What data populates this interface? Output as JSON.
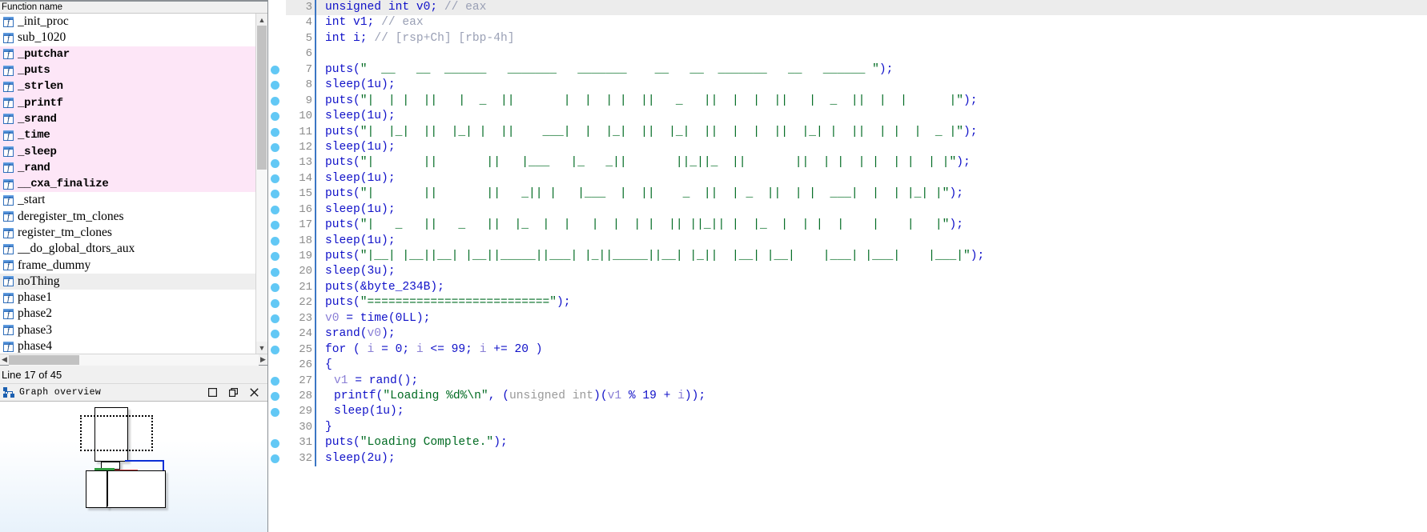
{
  "functions_panel": {
    "header": "Function name",
    "status": "Line 17 of 45",
    "icon_letter": "f",
    "items": [
      {
        "label": "_init_proc",
        "state": "normal"
      },
      {
        "label": "sub_1020",
        "state": "normal"
      },
      {
        "label": "_putchar",
        "state": "pink"
      },
      {
        "label": "_puts",
        "state": "pink"
      },
      {
        "label": "_strlen",
        "state": "pink"
      },
      {
        "label": "_printf",
        "state": "pink"
      },
      {
        "label": "_srand",
        "state": "pink"
      },
      {
        "label": "_time",
        "state": "pink"
      },
      {
        "label": "_sleep",
        "state": "pink"
      },
      {
        "label": "_rand",
        "state": "pink"
      },
      {
        "label": "__cxa_finalize",
        "state": "pink"
      },
      {
        "label": "_start",
        "state": "normal"
      },
      {
        "label": "deregister_tm_clones",
        "state": "normal"
      },
      {
        "label": "register_tm_clones",
        "state": "normal"
      },
      {
        "label": "__do_global_dtors_aux",
        "state": "normal"
      },
      {
        "label": "frame_dummy",
        "state": "normal"
      },
      {
        "label": "noThing",
        "state": "selected"
      },
      {
        "label": "phase1",
        "state": "normal"
      },
      {
        "label": "phase2",
        "state": "normal"
      },
      {
        "label": "phase3",
        "state": "normal"
      },
      {
        "label": "phase4",
        "state": "normal"
      }
    ]
  },
  "graph_overview": {
    "title": "Graph overview",
    "buttons": [
      "maximize-button",
      "restore-button",
      "close-button"
    ]
  },
  "pseudocode": {
    "lines": [
      {
        "n": 3,
        "bp": false,
        "current": true,
        "indent": 1,
        "tokens": [
          {
            "t": "unsigned int v0; ",
            "c": "kw"
          },
          {
            "t": "// eax",
            "c": "cmt"
          }
        ]
      },
      {
        "n": 4,
        "bp": false,
        "current": false,
        "indent": 1,
        "tokens": [
          {
            "t": "int v1; ",
            "c": "kw"
          },
          {
            "t": "// eax",
            "c": "cmt"
          }
        ]
      },
      {
        "n": 5,
        "bp": false,
        "current": false,
        "indent": 1,
        "tokens": [
          {
            "t": "int i; ",
            "c": "kw"
          },
          {
            "t": "// [rsp+Ch] [rbp-4h]",
            "c": "cmt"
          }
        ]
      },
      {
        "n": 6,
        "bp": false,
        "current": false,
        "indent": 1,
        "tokens": []
      },
      {
        "n": 7,
        "bp": true,
        "current": false,
        "indent": 1,
        "tokens": [
          {
            "t": "puts(",
            "c": "kw"
          },
          {
            "t": "\"  __   __  ______   _______   _______    __   __  _______   __   ______ \"",
            "c": "str"
          },
          {
            "t": ");",
            "c": "kw"
          }
        ]
      },
      {
        "n": 8,
        "bp": true,
        "current": false,
        "indent": 1,
        "tokens": [
          {
            "t": "sleep(1u);",
            "c": "kw"
          }
        ]
      },
      {
        "n": 9,
        "bp": true,
        "current": false,
        "indent": 1,
        "tokens": [
          {
            "t": "puts(",
            "c": "kw"
          },
          {
            "t": "\"|  | |  ||   |  _  ||       |  |  | |  ||   _   ||  |  |  ||   |  _  ||  |  |      |\"",
            "c": "str"
          },
          {
            "t": ");",
            "c": "kw"
          }
        ]
      },
      {
        "n": 10,
        "bp": true,
        "current": false,
        "indent": 1,
        "tokens": [
          {
            "t": "sleep(1u);",
            "c": "kw"
          }
        ]
      },
      {
        "n": 11,
        "bp": true,
        "current": false,
        "indent": 1,
        "tokens": [
          {
            "t": "puts(",
            "c": "kw"
          },
          {
            "t": "\"|  |_|  ||  |_| |  ||    ___|  |  |_|  ||  |_|  ||  |  |  ||  |_| |  ||  | |  |  _ |\"",
            "c": "str"
          },
          {
            "t": ");",
            "c": "kw"
          }
        ]
      },
      {
        "n": 12,
        "bp": true,
        "current": false,
        "indent": 1,
        "tokens": [
          {
            "t": "sleep(1u);",
            "c": "kw"
          }
        ]
      },
      {
        "n": 13,
        "bp": true,
        "current": false,
        "indent": 1,
        "tokens": [
          {
            "t": "puts(",
            "c": "kw"
          },
          {
            "t": "\"|       ||       ||   |___   |_   _||       ||_||_  ||       ||  | |  | |  | |  | |\"",
            "c": "str"
          },
          {
            "t": ");",
            "c": "kw"
          }
        ]
      },
      {
        "n": 14,
        "bp": true,
        "current": false,
        "indent": 1,
        "tokens": [
          {
            "t": "sleep(1u);",
            "c": "kw"
          }
        ]
      },
      {
        "n": 15,
        "bp": true,
        "current": false,
        "indent": 1,
        "tokens": [
          {
            "t": "puts(",
            "c": "kw"
          },
          {
            "t": "\"|       ||       ||   _|| |   |___  |  ||    _  ||  | _  ||  | |  ___|  |  | |_| |\"",
            "c": "str"
          },
          {
            "t": ");",
            "c": "kw"
          }
        ]
      },
      {
        "n": 16,
        "bp": true,
        "current": false,
        "indent": 1,
        "tokens": [
          {
            "t": "sleep(1u);",
            "c": "kw"
          }
        ]
      },
      {
        "n": 17,
        "bp": true,
        "current": false,
        "indent": 1,
        "tokens": [
          {
            "t": "puts(",
            "c": "kw"
          },
          {
            "t": "\"|   _   ||   _   ||  |_  |  |   |  |  | |  || ||_|| |  |_  |  | |  |    |    |   |\"",
            "c": "str"
          },
          {
            "t": ");",
            "c": "kw"
          }
        ]
      },
      {
        "n": 18,
        "bp": true,
        "current": false,
        "indent": 1,
        "tokens": [
          {
            "t": "sleep(1u);",
            "c": "kw"
          }
        ]
      },
      {
        "n": 19,
        "bp": true,
        "current": false,
        "indent": 1,
        "tokens": [
          {
            "t": "puts(",
            "c": "kw"
          },
          {
            "t": "\"|__| |__||__| |__||_____||___| |_||_____||__| |_||  |__| |__|    |___| |___|    |___|\"",
            "c": "str"
          },
          {
            "t": ");",
            "c": "kw"
          }
        ]
      },
      {
        "n": 20,
        "bp": true,
        "current": false,
        "indent": 1,
        "tokens": [
          {
            "t": "sleep(3u);",
            "c": "kw"
          }
        ]
      },
      {
        "n": 21,
        "bp": true,
        "current": false,
        "indent": 1,
        "tokens": [
          {
            "t": "puts(&byte_234B);",
            "c": "kw"
          }
        ]
      },
      {
        "n": 22,
        "bp": true,
        "current": false,
        "indent": 1,
        "tokens": [
          {
            "t": "puts(",
            "c": "kw"
          },
          {
            "t": "\"==========================\"",
            "c": "str"
          },
          {
            "t": ");",
            "c": "kw"
          }
        ]
      },
      {
        "n": 23,
        "bp": true,
        "current": false,
        "indent": 1,
        "tokens": [
          {
            "t": "v0",
            "c": "var"
          },
          {
            "t": " = time(0LL);",
            "c": "kw"
          }
        ]
      },
      {
        "n": 24,
        "bp": true,
        "current": false,
        "indent": 1,
        "tokens": [
          {
            "t": "srand(",
            "c": "kw"
          },
          {
            "t": "v0",
            "c": "var"
          },
          {
            "t": ");",
            "c": "kw"
          }
        ]
      },
      {
        "n": 25,
        "bp": true,
        "current": false,
        "indent": 1,
        "tokens": [
          {
            "t": "for ( ",
            "c": "kw"
          },
          {
            "t": "i",
            "c": "var"
          },
          {
            "t": " = 0; ",
            "c": "kw"
          },
          {
            "t": "i",
            "c": "var"
          },
          {
            "t": " <= 99; ",
            "c": "kw"
          },
          {
            "t": "i",
            "c": "var"
          },
          {
            "t": " += 20 )",
            "c": "kw"
          }
        ]
      },
      {
        "n": 26,
        "bp": false,
        "current": false,
        "indent": 1,
        "tokens": [
          {
            "t": "{",
            "c": "kw"
          }
        ]
      },
      {
        "n": 27,
        "bp": true,
        "current": false,
        "indent": 2,
        "tokens": [
          {
            "t": "v1",
            "c": "var"
          },
          {
            "t": " = rand();",
            "c": "kw"
          }
        ]
      },
      {
        "n": 28,
        "bp": true,
        "current": false,
        "indent": 2,
        "tokens": [
          {
            "t": "printf(",
            "c": "kw"
          },
          {
            "t": "\"Loading %d%\\n\"",
            "c": "str"
          },
          {
            "t": ", (",
            "c": "kw"
          },
          {
            "t": "unsigned int",
            "c": "typ"
          },
          {
            "t": ")(",
            "c": "kw"
          },
          {
            "t": "v1",
            "c": "var"
          },
          {
            "t": " % 19 + ",
            "c": "kw"
          },
          {
            "t": "i",
            "c": "var"
          },
          {
            "t": "));",
            "c": "kw"
          }
        ]
      },
      {
        "n": 29,
        "bp": true,
        "current": false,
        "indent": 2,
        "tokens": [
          {
            "t": "sleep(1u);",
            "c": "kw"
          }
        ]
      },
      {
        "n": 30,
        "bp": false,
        "current": false,
        "indent": 1,
        "tokens": [
          {
            "t": "}",
            "c": "kw"
          }
        ]
      },
      {
        "n": 31,
        "bp": true,
        "current": false,
        "indent": 1,
        "tokens": [
          {
            "t": "puts(",
            "c": "kw"
          },
          {
            "t": "\"Loading Complete.\"",
            "c": "str"
          },
          {
            "t": ");",
            "c": "kw"
          }
        ]
      },
      {
        "n": 32,
        "bp": true,
        "current": false,
        "indent": 1,
        "tokens": [
          {
            "t": "sleep(2u);",
            "c": "kw"
          }
        ]
      }
    ]
  },
  "colors": {
    "string": "#006b22",
    "keyword": "#0f10c8",
    "comment": "#9aa0b5",
    "variable": "#8a7fd6",
    "cast_type": "#9a9a9a",
    "breakpoint_dot": "#62c8f5",
    "highlight_pink": "#fde6f7",
    "selected_row": "#eeeeee",
    "current_line": "#ececec"
  }
}
